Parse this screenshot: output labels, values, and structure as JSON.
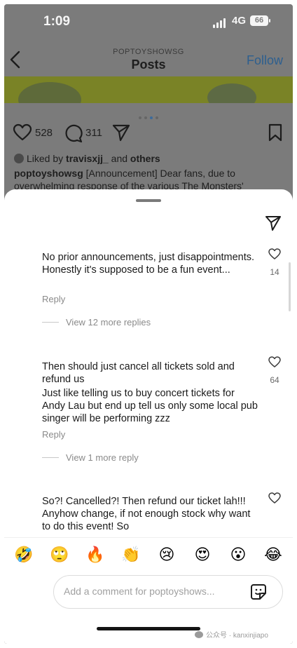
{
  "status_bar": {
    "time": "1:09",
    "network": "4G",
    "battery": "66"
  },
  "header": {
    "account": "POPTOYSHOWSG",
    "title": "Posts",
    "follow_label": "Follow"
  },
  "post": {
    "likes_count": "528",
    "comments_count": "311",
    "liked_by_prefix": "Liked by",
    "liked_by_user": "travisxjj_",
    "liked_by_and": "and",
    "liked_by_others": "others",
    "caption_user": "poptoyshowsg",
    "caption_line1": "[Announcement] Dear fans, due to",
    "caption_line2": "overwhelming response of the various The Monsters'"
  },
  "comments": [
    {
      "text": "No prior announcements, just disappointments. Honestly it's supposed to be a fun event...",
      "likes": "14",
      "reply_label": "Reply",
      "view_replies": "View 12 more replies"
    },
    {
      "text_line1": "Then should just cancel all tickets sold and refund us",
      "text_line2": "Just like telling us to buy concert tickets for Andy Lau but end up tell us only some local pub singer will be performing zzz",
      "likes": "64",
      "reply_label": "Reply",
      "view_replies": "View 1 more reply"
    },
    {
      "text": "So?! Cancelled?! Then refund our ticket lah!!! Anyhow change, if not  enough stock why want to do this event!  So"
    }
  ],
  "emoji_bar": [
    "🤣",
    "🙄",
    "🔥",
    "👏",
    "😢",
    "😍",
    "😮",
    "😂"
  ],
  "comment_input": {
    "placeholder": "Add a comment for poptoyshows..."
  },
  "watermark": {
    "text": "公众号 · kanxinjiapo"
  },
  "icons": {
    "back": "chevron-left-icon",
    "heart": "heart-icon",
    "comment": "comment-bubble-icon",
    "share": "paper-plane-icon",
    "save": "bookmark-icon",
    "sticker": "sticker-icon"
  }
}
